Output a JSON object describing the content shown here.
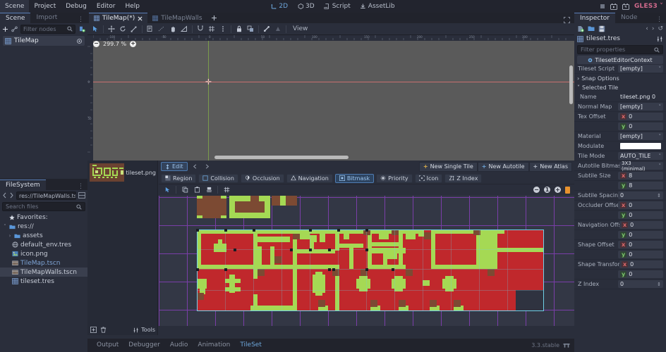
{
  "menubar": {
    "items": [
      "Scene",
      "Project",
      "Debug",
      "Editor",
      "Help"
    ],
    "center_buttons": [
      {
        "label": "2D",
        "icon": "move-2d-icon",
        "active": true
      },
      {
        "label": "3D",
        "icon": "cube-3d-icon",
        "active": false
      },
      {
        "label": "Script",
        "icon": "script-icon",
        "active": false
      },
      {
        "label": "AssetLib",
        "icon": "assetlib-icon",
        "active": false
      }
    ],
    "right": {
      "stop_icon": "stop-icon",
      "play_scene_icon": "play-scene-icon",
      "play_custom_icon": "play-custom-scene-icon",
      "renderer": "GLES3"
    }
  },
  "scene_panel": {
    "tabs": [
      {
        "label": "Scene",
        "selected": true
      },
      {
        "label": "Import",
        "selected": false
      }
    ],
    "filter_placeholder": "Filter nodes",
    "nodes": [
      {
        "label": "TileMap",
        "icon": "tilemap-icon",
        "selected": true
      }
    ]
  },
  "filesystem": {
    "tab": "FileSystem",
    "path": "res://TileMapWalls.tsc",
    "search_placeholder": "Search files",
    "items": [
      {
        "label": "Favorites:",
        "icon": "star-icon",
        "depth": 0,
        "type": "favorites"
      },
      {
        "label": "res://",
        "icon": "folder-icon",
        "depth": 0,
        "type": "folder",
        "expanded": true
      },
      {
        "label": "assets",
        "icon": "folder-icon",
        "depth": 1,
        "type": "folder",
        "expanded": false
      },
      {
        "label": "default_env.tres",
        "icon": "environment-icon",
        "depth": 1,
        "type": "file"
      },
      {
        "label": "icon.png",
        "icon": "image-icon",
        "depth": 1,
        "type": "file"
      },
      {
        "label": "TileMap.tscn",
        "icon": "scene-icon",
        "depth": 1,
        "type": "scene",
        "link": true
      },
      {
        "label": "TileMapWalls.tscn",
        "icon": "scene-icon",
        "depth": 1,
        "type": "scene",
        "selected": true
      },
      {
        "label": "tileset.tres",
        "icon": "tileset-icon",
        "depth": 1,
        "type": "file"
      }
    ]
  },
  "viewport": {
    "tabs": [
      {
        "label": "TileMap(*)",
        "icon": "scene-icon",
        "selected": true,
        "closable": true
      },
      {
        "label": "TileMapWalls",
        "icon": "scene-icon",
        "selected": false,
        "closable": false
      }
    ],
    "add_tab_label": "+",
    "toolbar": [
      {
        "name": "select-mode-icon",
        "active": true
      },
      {
        "name": "move-mode-icon",
        "active": false
      },
      {
        "name": "rotate-mode-icon",
        "active": false
      },
      {
        "name": "scale-mode-icon",
        "active": false
      },
      {
        "name": "list-mode-icon",
        "active": false
      },
      {
        "name": "ruler-mode-icon",
        "active": false
      },
      {
        "name": "pan-mode-icon",
        "active": false
      },
      {
        "name": "ruler-tool-icon",
        "active": false
      },
      {
        "name": "smart-snap-icon",
        "active": false
      },
      {
        "name": "grid-snap-icon",
        "active": false
      },
      {
        "name": "snap-options-icon",
        "active": false
      },
      {
        "name": "lock-icon",
        "active": false
      },
      {
        "name": "group-icon",
        "active": false
      },
      {
        "name": "bone-icon",
        "active": false
      },
      {
        "name": "skeleton-icon",
        "active": false
      }
    ],
    "view_menu": "View",
    "zoom_level": "299.7 %",
    "zoom_out_icon": "zoom-out-icon",
    "zoom_in_icon": "zoom-in-icon",
    "ruler_labels_h": [
      "-100",
      "-50",
      "0",
      "50",
      "100",
      "150",
      "200",
      "250",
      "300"
    ],
    "ruler_labels_v": [
      "0",
      "50"
    ]
  },
  "tileset_editor": {
    "texture": {
      "name": "tileset.png",
      "thumb_icon": "texture-thumb"
    },
    "edit_button": {
      "label": "Edit",
      "icon": "edit-icon"
    },
    "prev_icon": "prev-tile-icon",
    "next_icon": "next-tile-icon",
    "new_buttons": [
      {
        "label": "New Single Tile",
        "icon": "plus-icon",
        "color": "#e0b24a"
      },
      {
        "label": "New Autotile",
        "icon": "plus-icon",
        "color": "#6ea8dd"
      },
      {
        "label": "New Atlas",
        "icon": "plus-icon",
        "color": "#b8bfcc"
      }
    ],
    "modes": [
      {
        "label": "Region",
        "icon": "region-icon",
        "selected": false
      },
      {
        "label": "Collision",
        "icon": "collision-icon",
        "selected": false
      },
      {
        "label": "Occlusion",
        "icon": "occlusion-icon",
        "selected": false
      },
      {
        "label": "Navigation",
        "icon": "navigation-icon",
        "selected": false
      },
      {
        "label": "Bitmask",
        "icon": "bitmask-icon",
        "selected": true
      },
      {
        "label": "Priority",
        "icon": "priority-icon",
        "selected": false
      },
      {
        "label": "Icon",
        "icon": "icon-mode-icon",
        "selected": false
      },
      {
        "label": "Z Index",
        "icon": "zindex-icon",
        "selected": false
      }
    ],
    "canvas_tools": [
      {
        "name": "select-tool-icon",
        "active": true
      },
      {
        "name": "copy-icon",
        "active": false
      },
      {
        "name": "paste-icon",
        "active": false
      },
      {
        "name": "clear-icon",
        "active": false
      },
      {
        "name": "grid-icon",
        "active": false
      }
    ],
    "zoom_controls": [
      {
        "name": "zoom-out-icon"
      },
      {
        "name": "zoom-reset-icon"
      },
      {
        "name": "zoom-in-icon"
      },
      {
        "name": "snap-indicator-icon",
        "color": "#e8922e"
      }
    ],
    "bottom_tools": [
      {
        "name": "add-texture-icon"
      },
      {
        "name": "remove-texture-icon"
      }
    ],
    "tools_label": "Tools",
    "tools_icon": "tools-icon"
  },
  "bottom_dock": {
    "tabs": [
      {
        "label": "Output",
        "selected": false
      },
      {
        "label": "Debugger",
        "selected": false
      },
      {
        "label": "Audio",
        "selected": false
      },
      {
        "label": "Animation",
        "selected": false
      },
      {
        "label": "TileSet",
        "selected": true
      }
    ],
    "version": "3.3.stable",
    "version_icon": "godot-icon"
  },
  "inspector": {
    "tabs": [
      {
        "label": "Inspector",
        "selected": true
      },
      {
        "label": "Node",
        "selected": false
      }
    ],
    "toolbar": [
      {
        "name": "new-resource-icon"
      },
      {
        "name": "load-resource-icon"
      },
      {
        "name": "save-resource-icon"
      }
    ],
    "nav": [
      {
        "name": "history-back-icon",
        "label": "‹"
      },
      {
        "name": "history-forward-icon",
        "label": "›"
      },
      {
        "name": "history-menu-icon",
        "label": "↺"
      }
    ],
    "resource": {
      "name": "tileset.tres",
      "icon": "tileset-icon",
      "tools_icon": "object-tools-icon"
    },
    "filter_placeholder": "Filter properties",
    "context": {
      "label": "TilesetEditorContext",
      "icon": "object-icon"
    },
    "properties": [
      {
        "key": "Tileset Script",
        "value": "[empty]",
        "type": "dropdown"
      },
      {
        "key": "Snap Options",
        "type": "section",
        "expanded": false
      },
      {
        "key": "Selected Tile",
        "type": "section",
        "expanded": true
      },
      {
        "key": "Name",
        "value": "tileset.png 0",
        "type": "text",
        "indent": true
      },
      {
        "key": "Normal Map",
        "value": "[empty]",
        "type": "dropdown",
        "indent": true
      },
      {
        "key": "Tex Offset",
        "value": "0",
        "type": "vec-x",
        "indent": true
      },
      {
        "key": "",
        "value": "0",
        "type": "vec-y",
        "indent": true
      },
      {
        "key": "Material",
        "value": "[empty]",
        "type": "dropdown",
        "indent": true
      },
      {
        "key": "Modulate",
        "value": "#ffffff",
        "type": "color",
        "indent": true
      },
      {
        "key": "Tile Mode",
        "value": "AUTO_TILE",
        "type": "dropdown",
        "indent": true
      },
      {
        "key": "Autotile Bitmask",
        "value": "3X3 (minimal)",
        "type": "dropdown",
        "indent": true
      },
      {
        "key": "Subtile Size",
        "value": "8",
        "type": "vec-x",
        "indent": true
      },
      {
        "key": "",
        "value": "8",
        "type": "vec-y",
        "indent": true
      },
      {
        "key": "Subtile Spacing",
        "value": "0",
        "type": "spin",
        "indent": true
      },
      {
        "key": "Occluder Offset",
        "value": "0",
        "type": "vec-x",
        "indent": true
      },
      {
        "key": "",
        "value": "0",
        "type": "vec-y",
        "indent": true
      },
      {
        "key": "Navigation Offs",
        "value": "0",
        "type": "vec-x",
        "indent": true
      },
      {
        "key": "",
        "value": "0",
        "type": "vec-y",
        "indent": true
      },
      {
        "key": "Shape Offset",
        "value": "0",
        "type": "vec-x",
        "indent": true
      },
      {
        "key": "",
        "value": "0",
        "type": "vec-y",
        "indent": true
      },
      {
        "key": "Shape Transfor",
        "value": "0",
        "type": "vec-x",
        "indent": true
      },
      {
        "key": "",
        "value": "0",
        "type": "vec-y",
        "indent": true
      },
      {
        "key": "Z Index",
        "value": "0",
        "type": "spin",
        "indent": true
      }
    ]
  },
  "colors": {
    "accent": "#6ea8dd",
    "bg_dark": "#21232c",
    "panel": "#2a2e3b",
    "tile_red": "#c0282c",
    "tile_green": "#a5d954",
    "tile_brown": "#7c4a33",
    "grid_purple": "#7a3ea8",
    "selection_cyan": "#6fd0e8"
  }
}
